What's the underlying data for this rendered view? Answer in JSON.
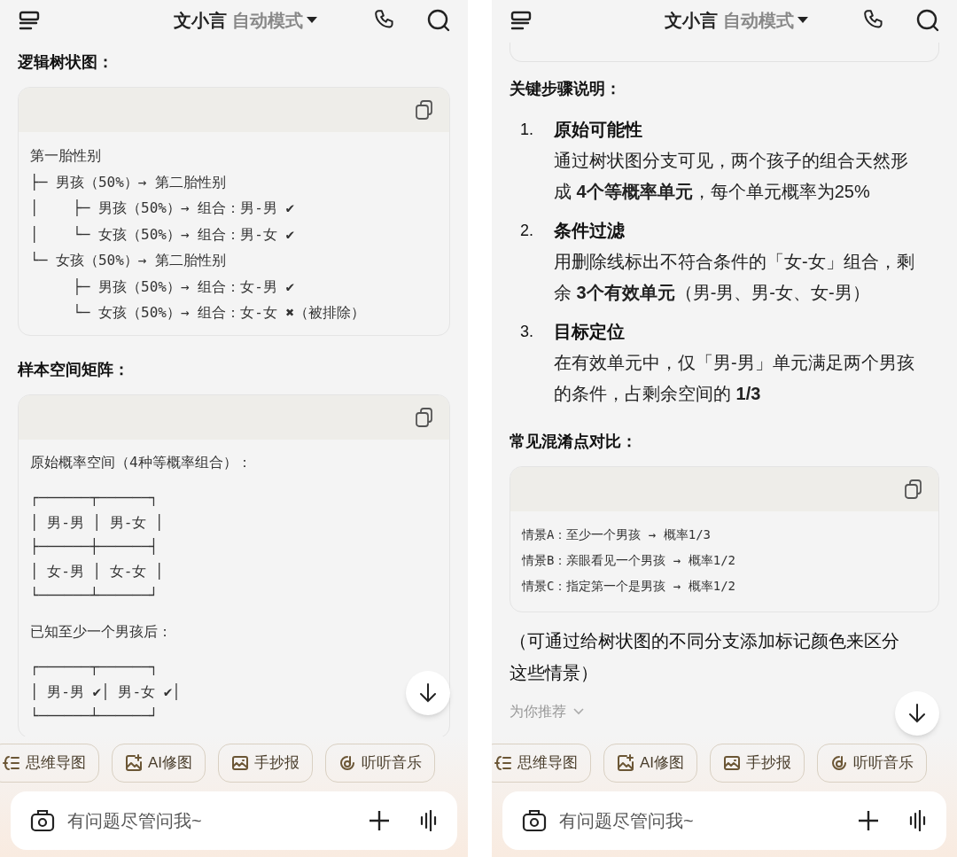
{
  "screens": [
    {
      "header": {
        "title": "文小言",
        "mode": "自动模式"
      },
      "blocks": [
        {
          "kind": "heading",
          "text": "逻辑树状图："
        },
        {
          "kind": "code",
          "groups": [
            [
              "第一胎性别",
              "├─ 男孩（50%）→ 第二胎性别",
              "│    ├─ 男孩（50%）→ 组合：男-男 ✔",
              "│    └─ 女孩（50%）→ 组合：男-女 ✔",
              "└─ 女孩（50%）→ 第二胎性别",
              "     ├─ 男孩（50%）→ 组合：女-男 ✔",
              "     └─ 女孩（50%）→ 组合：女-女 ✖（被排除）"
            ]
          ]
        },
        {
          "kind": "heading",
          "text": "样本空间矩阵："
        },
        {
          "kind": "code",
          "groups": [
            [
              "原始概率空间（4种等概率组合）："
            ],
            [
              "┌──────┬──────┐",
              "│ 男-男 │ 男-女 │",
              "├──────┼──────┤",
              "│ 女-男 │ 女-女 │",
              "└──────┴──────┘"
            ],
            [
              "已知至少一个男孩后："
            ],
            [
              "┌──────┬──────┐",
              "│ 男-男 ✔│ 男-女 ✔│",
              "└──────┴──────┘"
            ]
          ]
        }
      ],
      "chips": [
        {
          "kind": "mindmap",
          "label": "思维导图"
        },
        {
          "kind": "image",
          "label": "AI修图"
        },
        {
          "kind": "poster",
          "label": "手抄报"
        },
        {
          "kind": "music",
          "label": "听听音乐"
        }
      ],
      "input": {
        "placeholder": "有问题尽管问我~"
      }
    },
    {
      "header": {
        "title": "文小言",
        "mode": "自动模式"
      },
      "blocks": [
        {
          "kind": "card_end"
        },
        {
          "kind": "heading",
          "text": "关键步骤说明："
        },
        {
          "kind": "steps",
          "items": [
            {
              "number": "1.",
              "title": "原始可能性",
              "body": "通过树状图分支可见，两个孩子的组合天然形成 **4个等概率单元**，每个单元概率为25%"
            },
            {
              "number": "2.",
              "title": "条件过滤",
              "body": "用删除线标出不符合条件的「女-女」组合，剩余 **3个有效单元**（男-男、男-女、女-男）"
            },
            {
              "number": "3.",
              "title": "目标定位",
              "body": "在有效单元中，仅「男-男」单元满足两个男孩的条件，占剩余空间的 **1/3**"
            }
          ]
        },
        {
          "kind": "heading",
          "text": "常见混淆点对比："
        },
        {
          "kind": "code",
          "small": true,
          "groups": [
            [
              "情景A：至少一个男孩 → 概率1/3",
              "情景B：亲眼看见一个男孩 → 概率1/2",
              "情景C：指定第一个是男孩 → 概率1/2"
            ]
          ]
        },
        {
          "kind": "paragraph",
          "text": "（可通过给树状图的不同分支添加标记颜色来区分这些情景）"
        },
        {
          "kind": "recommend",
          "text": "为你推荐"
        }
      ],
      "chips": [
        {
          "kind": "mindmap",
          "label": "思维导图"
        },
        {
          "kind": "image",
          "label": "AI修图"
        },
        {
          "kind": "poster",
          "label": "手抄报"
        },
        {
          "kind": "music",
          "label": "听听音乐"
        }
      ],
      "input": {
        "placeholder": "有问题尽管问我~"
      }
    }
  ]
}
